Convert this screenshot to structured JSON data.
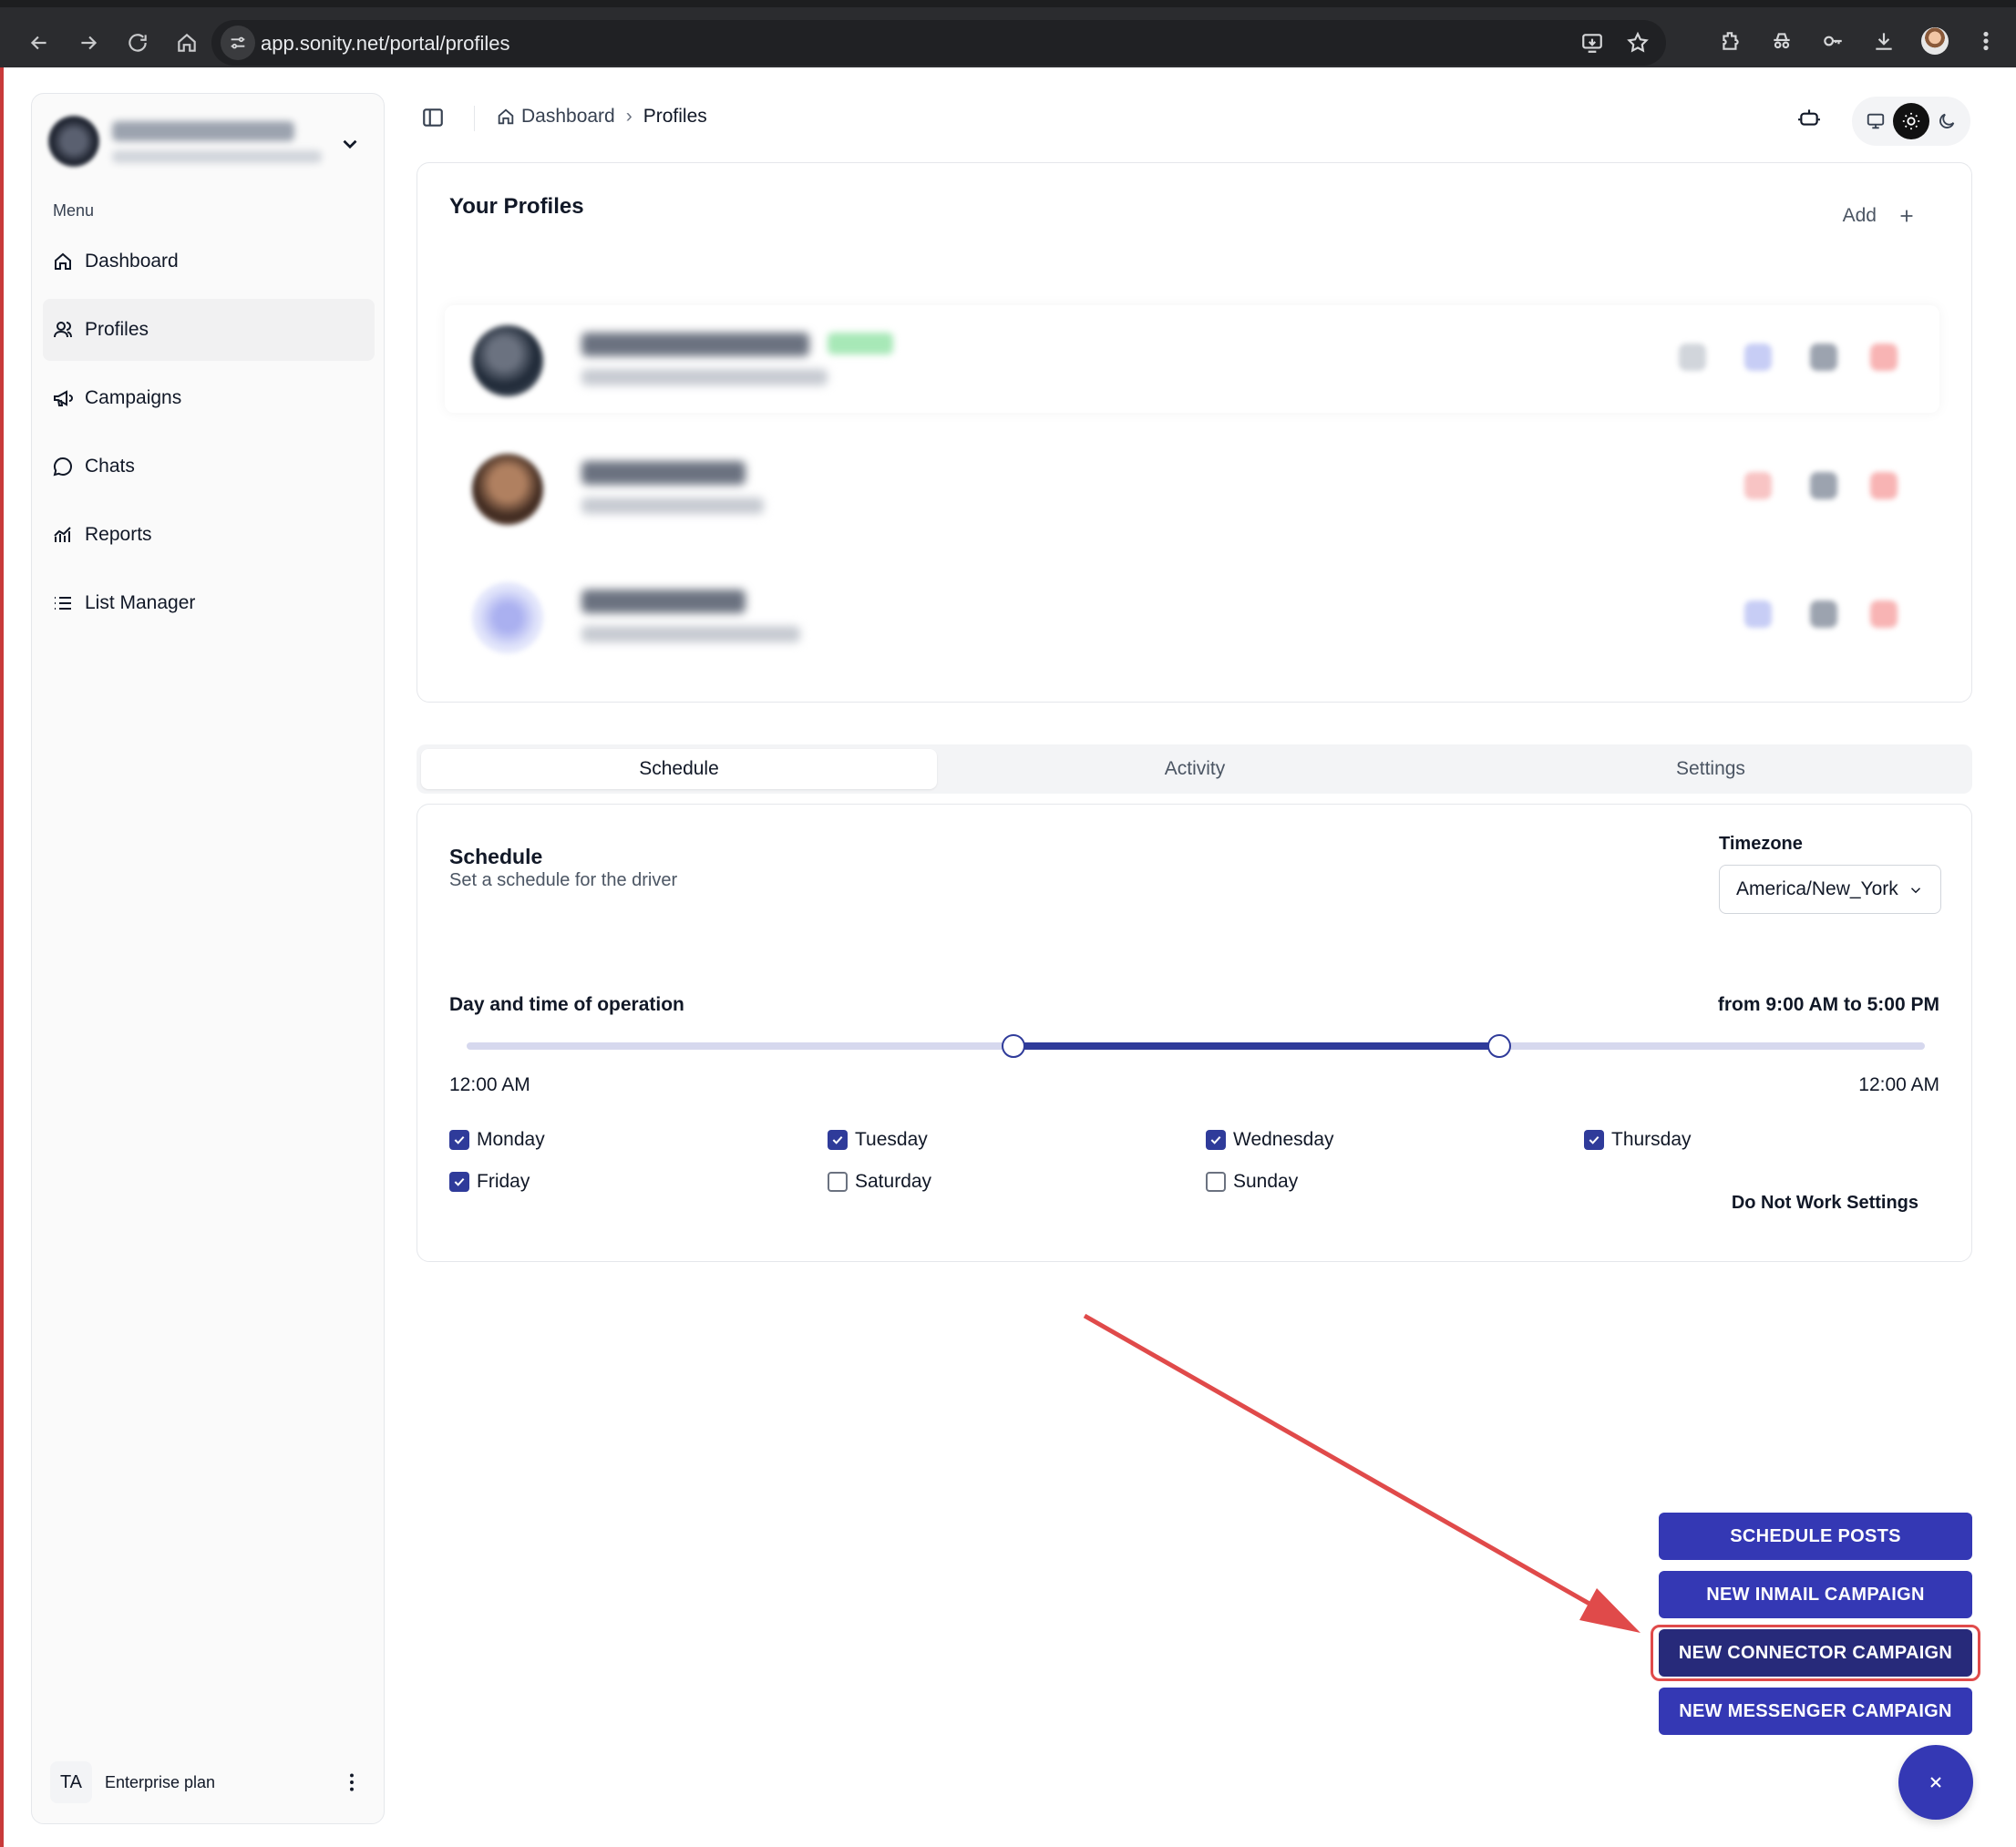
{
  "browser": {
    "url": "app.sonity.net/portal/profiles"
  },
  "sidebar": {
    "menu_label": "Menu",
    "items": [
      {
        "label": "Dashboard",
        "icon": "home-icon"
      },
      {
        "label": "Profiles",
        "icon": "users-icon",
        "active": true
      },
      {
        "label": "Campaigns",
        "icon": "megaphone-icon"
      },
      {
        "label": "Chats",
        "icon": "chat-bubble-icon"
      },
      {
        "label": "Reports",
        "icon": "chart-icon"
      },
      {
        "label": "List Manager",
        "icon": "list-icon"
      }
    ],
    "footer": {
      "initials": "TA",
      "plan": "Enterprise plan"
    }
  },
  "header": {
    "breadcrumb": [
      "Dashboard",
      "Profiles"
    ]
  },
  "profiles_card": {
    "title": "Your Profiles",
    "add_label": "Add"
  },
  "tabs": [
    "Schedule",
    "Activity",
    "Settings"
  ],
  "schedule": {
    "title": "Schedule",
    "subtitle": "Set a schedule for the driver",
    "timezone_label": "Timezone",
    "timezone_value": "America/New_York",
    "operation_label": "Day and time of operation",
    "range_text": "from 9:00 AM to 5:00 PM",
    "slider_start_fraction": 0.375,
    "slider_end_fraction": 0.7083,
    "min_label": "12:00 AM",
    "max_label": "12:00 AM",
    "days": [
      {
        "label": "Monday",
        "checked": true
      },
      {
        "label": "Tuesday",
        "checked": true
      },
      {
        "label": "Wednesday",
        "checked": true
      },
      {
        "label": "Thursday",
        "checked": true
      },
      {
        "label": "Friday",
        "checked": true
      },
      {
        "label": "Saturday",
        "checked": false
      },
      {
        "label": "Sunday",
        "checked": false
      }
    ],
    "do_not_work": "Do Not Work Settings"
  },
  "actions": [
    "SCHEDULE POSTS",
    "NEW INMAIL CAMPAIGN",
    "NEW CONNECTOR CAMPAIGN",
    "NEW MESSENGER CAMPAIGN"
  ],
  "colors": {
    "primary": "#3438b4",
    "highlight": "#e04a4a",
    "slider_fill": "#2f3b9a"
  }
}
